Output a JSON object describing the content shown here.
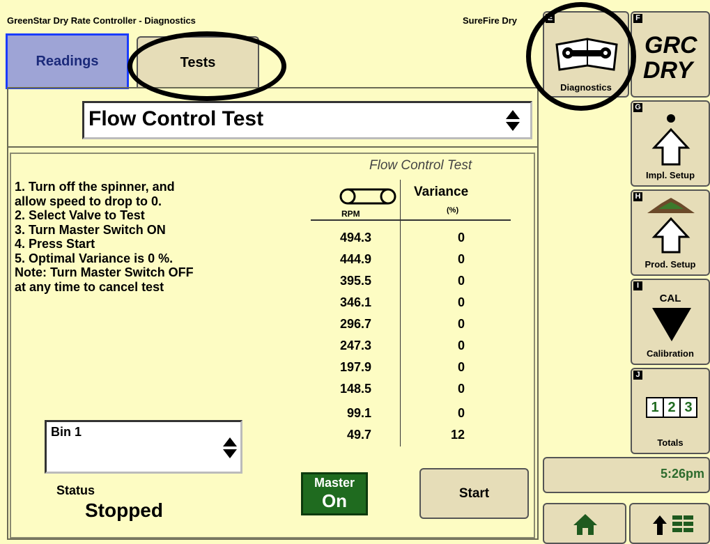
{
  "header": {
    "title": "GreenStar Dry Rate Controller - Diagnostics",
    "device": "SureFire Dry"
  },
  "tabs": [
    {
      "label": "Readings"
    },
    {
      "label": "Tests"
    }
  ],
  "test_select": {
    "value": "Flow Control Test"
  },
  "panel_title": "Flow Control Test",
  "instructions": [
    "1. Turn off the spinner, and",
    "allow speed to drop to 0.",
    "2. Select Valve to Test",
    "3. Turn Master Switch ON",
    "4. Press Start",
    "5. Optimal Variance is 0 %.",
    "Note: Turn Master Switch OFF",
    "at any time to cancel test"
  ],
  "table": {
    "col_rpm": "RPM",
    "col_variance": "Variance",
    "col_variance_unit": "(%)",
    "rows": [
      {
        "rpm": "494.3",
        "variance": "0"
      },
      {
        "rpm": "444.9",
        "variance": "0"
      },
      {
        "rpm": "395.5",
        "variance": "0"
      },
      {
        "rpm": "346.1",
        "variance": "0"
      },
      {
        "rpm": "296.7",
        "variance": "0"
      },
      {
        "rpm": "247.3",
        "variance": "0"
      },
      {
        "rpm": "197.9",
        "variance": "0"
      },
      {
        "rpm": "148.5",
        "variance": "0"
      },
      {
        "rpm": "99.1",
        "variance": "0"
      },
      {
        "rpm": "49.7",
        "variance": "12"
      }
    ]
  },
  "bin_select": {
    "value": "Bin 1"
  },
  "status": {
    "label": "Status",
    "value": "Stopped"
  },
  "master": {
    "line1": "Master",
    "line2": "On"
  },
  "start_label": "Start",
  "softkeys": {
    "E": {
      "letter": "E",
      "label": "Diagnostics",
      "icon": "wrench-book-icon"
    },
    "F": {
      "letter": "F",
      "line1": "GRC",
      "line2": "DRY"
    },
    "G": {
      "letter": "G",
      "label": "Impl. Setup",
      "icon": "up-arrow-icon"
    },
    "H": {
      "letter": "H",
      "label": "Prod. Setup",
      "icon": "pile-arrow-icon"
    },
    "I": {
      "letter": "I",
      "label": "Calibration",
      "cal": "CAL"
    },
    "J": {
      "letter": "J",
      "label": "Totals",
      "digits": [
        "1",
        "2",
        "3"
      ]
    }
  },
  "time": "5:26pm",
  "colors": {
    "background": "#fdfcc3",
    "button": "#e6ddb8",
    "readings_tab": "#9ea4d6",
    "master_on": "#1f6b1f",
    "time_text": "#2d6b2d"
  }
}
